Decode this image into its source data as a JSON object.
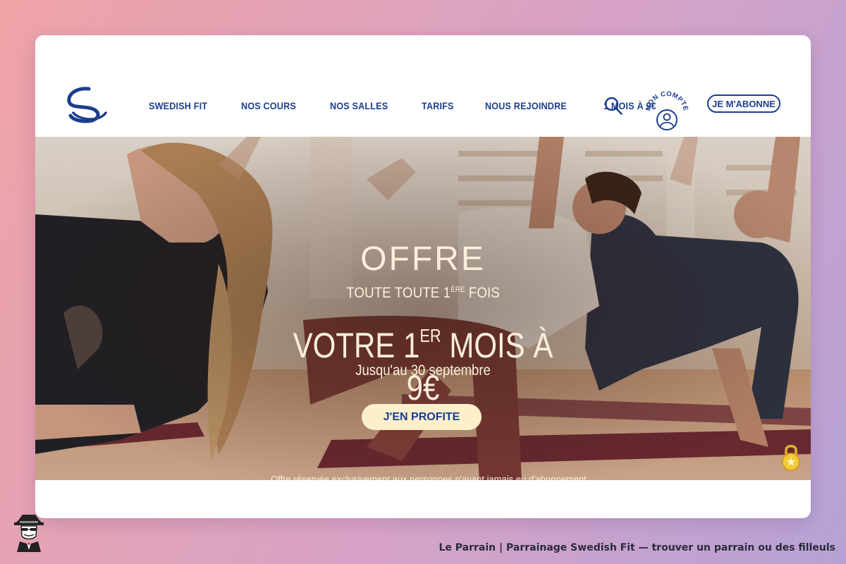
{
  "nav": {
    "menu": [
      "SWEDISH FIT",
      "NOS COURS",
      "NOS SALLES",
      "TARIFS",
      "NOUS REJOINDRE",
      "1 MOIS À 9€"
    ],
    "account_label": "MON COMPTE",
    "subscribe_label": "JE M'ABONNE"
  },
  "hero": {
    "offre": "OFFRE",
    "subtitle_prefix": "TOUTE TOUTE 1",
    "subtitle_sup": "ÈRE",
    "subtitle_suffix": " FOIS",
    "headline_prefix": "VOTRE 1",
    "headline_sup": "ER",
    "headline_suffix": " MOIS À 9€",
    "dates": "Jusqu'au 30 septembre",
    "cta_label": "J'EN PROFITE",
    "fine_print": "Offre réservée exclusivement aux personnes n'ayant jamais eu d'abonnement"
  },
  "footer": {
    "caption": "Le Parrain | Parrainage Swedish Fit — trouver un parrain ou des filleuls"
  },
  "colors": {
    "brand_blue": "#1c3d8f",
    "cream": "#fbeeda",
    "cta_bg": "#fbf0c9"
  },
  "icons": [
    "swedish-fit-logo-icon",
    "search-icon",
    "account-icon",
    "lock-icon",
    "parrain-mascot-icon"
  ]
}
